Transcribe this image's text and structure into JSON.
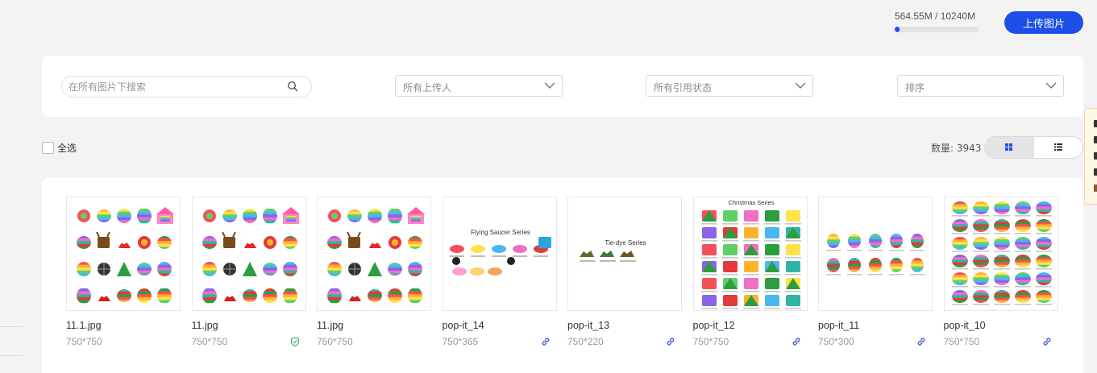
{
  "storage": {
    "text": "564.55M / 10240M",
    "used_fraction": 0.055
  },
  "upload_button": "上传图片",
  "filters": {
    "search_placeholder": "在所有图片下搜索",
    "uploader": "所有上传人",
    "reference_status": "所有引用状态",
    "sort": "排序"
  },
  "select_all": "全选",
  "count_label": "数量: 3943",
  "view": {
    "active": "grid"
  },
  "colors": {
    "accent": "#1d4ee8",
    "link_icon": "#2b4fd0",
    "shield_icon": "#2fae60"
  },
  "images": [
    {
      "name": "11.1.jpg",
      "size": "750*750",
      "badge": "none",
      "thumb": "toys"
    },
    {
      "name": "11.jpg",
      "size": "750*750",
      "badge": "shield-icon",
      "thumb": "toys"
    },
    {
      "name": "11.jpg",
      "size": "750*750",
      "badge": "none",
      "thumb": "toys"
    },
    {
      "name": "pop-it_14",
      "size": "750*365",
      "badge": "link-icon",
      "thumb": "series",
      "caption": "Flying Saucer Series"
    },
    {
      "name": "pop-it_13",
      "size": "750*220",
      "badge": "link-icon",
      "thumb": "series",
      "caption": "Tie-dye Series"
    },
    {
      "name": "pop-it_12",
      "size": "750*750",
      "badge": "link-icon",
      "thumb": "catalog",
      "caption": "Christmas Series"
    },
    {
      "name": "pop-it_11",
      "size": "750*300",
      "badge": "link-icon",
      "thumb": "strip"
    },
    {
      "name": "pop-it_10",
      "size": "750*750",
      "badge": "link-icon",
      "thumb": "catalog"
    }
  ]
}
